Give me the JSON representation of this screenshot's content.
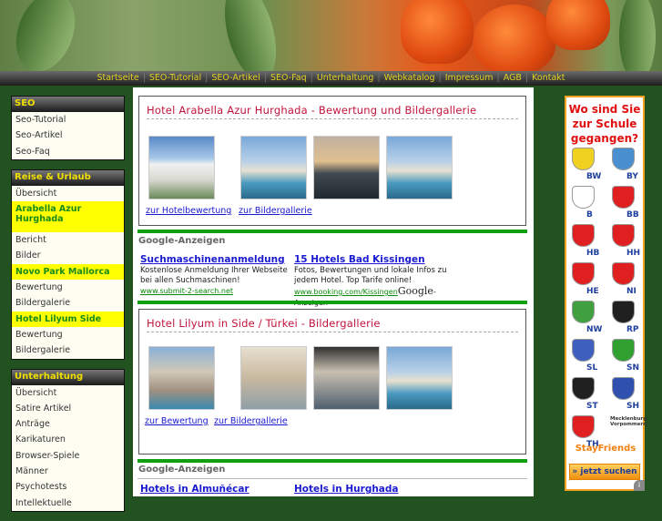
{
  "nav": [
    "Startseite",
    "SEO-Tutorial",
    "SEO-Artikel",
    "SEO-Faq",
    "Unterhaltung",
    "Webkatalog",
    "Impressum",
    "AGB",
    "Kontakt"
  ],
  "sidebar": [
    {
      "title": "SEO",
      "items": [
        {
          "label": "Seo-Tutorial"
        },
        {
          "label": "Seo-Artikel"
        },
        {
          "label": "Seo-Faq"
        }
      ]
    },
    {
      "title": "Reise & Urlaub",
      "items": [
        {
          "label": "Übersicht"
        },
        {
          "label": "Arabella Azur Hurghada",
          "hl": true
        },
        {
          "label": "Bericht"
        },
        {
          "label": "Bilder"
        },
        {
          "label": "Novo Park Mallorca",
          "hl": true
        },
        {
          "label": "Bewertung"
        },
        {
          "label": "Bildergalerie"
        },
        {
          "label": "Hotel Lilyum Side",
          "hl": true
        },
        {
          "label": "Bewertung"
        },
        {
          "label": "Bildergalerie"
        }
      ]
    },
    {
      "title": "Unterhaltung",
      "items": [
        {
          "label": "Übersicht"
        },
        {
          "label": "Satire Artikel"
        },
        {
          "label": "Anträge"
        },
        {
          "label": "Karikaturen"
        },
        {
          "label": "Browser-Spiele"
        },
        {
          "label": "Männer"
        },
        {
          "label": "Psychotests"
        },
        {
          "label": "Intellektuelle"
        }
      ]
    }
  ],
  "main": {
    "box1": {
      "title": "Hotel Arabella Azur Hurghada - Bewertung und Bildergallerie",
      "link1": "zur Hotelbewertung",
      "link2": "zur Bildergallerie"
    },
    "ads1": {
      "heading": "Google-Anzeigen",
      "items": [
        {
          "title": "Suchmaschinenanmeldung",
          "text": "Kostenlose Anmeldung Ihrer Webseite bei allen Suchmaschinen!",
          "url": "www.submit-2-search.net"
        },
        {
          "title": "15 Hotels Bad Kissingen",
          "text": "Fotos, Bewertungen und lokale Infos zu jedem Hotel. Top Tarife online!",
          "url": "www.booking.com/Kissingen"
        }
      ],
      "badge_google": "Google",
      "badge_text": "-Anzeigen"
    },
    "box2": {
      "title": "Hotel Lilyum in Side / Türkei - Bildergallerie",
      "link1": "zur Bewertung",
      "link2": "zur Bildergallerie"
    },
    "ads2": {
      "heading": "Google-Anzeigen",
      "items": [
        {
          "title": "Hotels in Almuñécar"
        },
        {
          "title": "Hotels in Hurghada"
        }
      ]
    }
  },
  "right_ad": {
    "question": "Wo sind Sie zur Schule gegangen?",
    "states": [
      "BW",
      "BY",
      "B",
      "BB",
      "HB",
      "HH",
      "HE",
      "NI",
      "NW",
      "RP",
      "SL",
      "SN",
      "ST",
      "SH",
      "TH"
    ],
    "mv": "Mecklenburg Vorpommern",
    "brand": "StayFriends",
    "button": "» jetzt suchen"
  }
}
